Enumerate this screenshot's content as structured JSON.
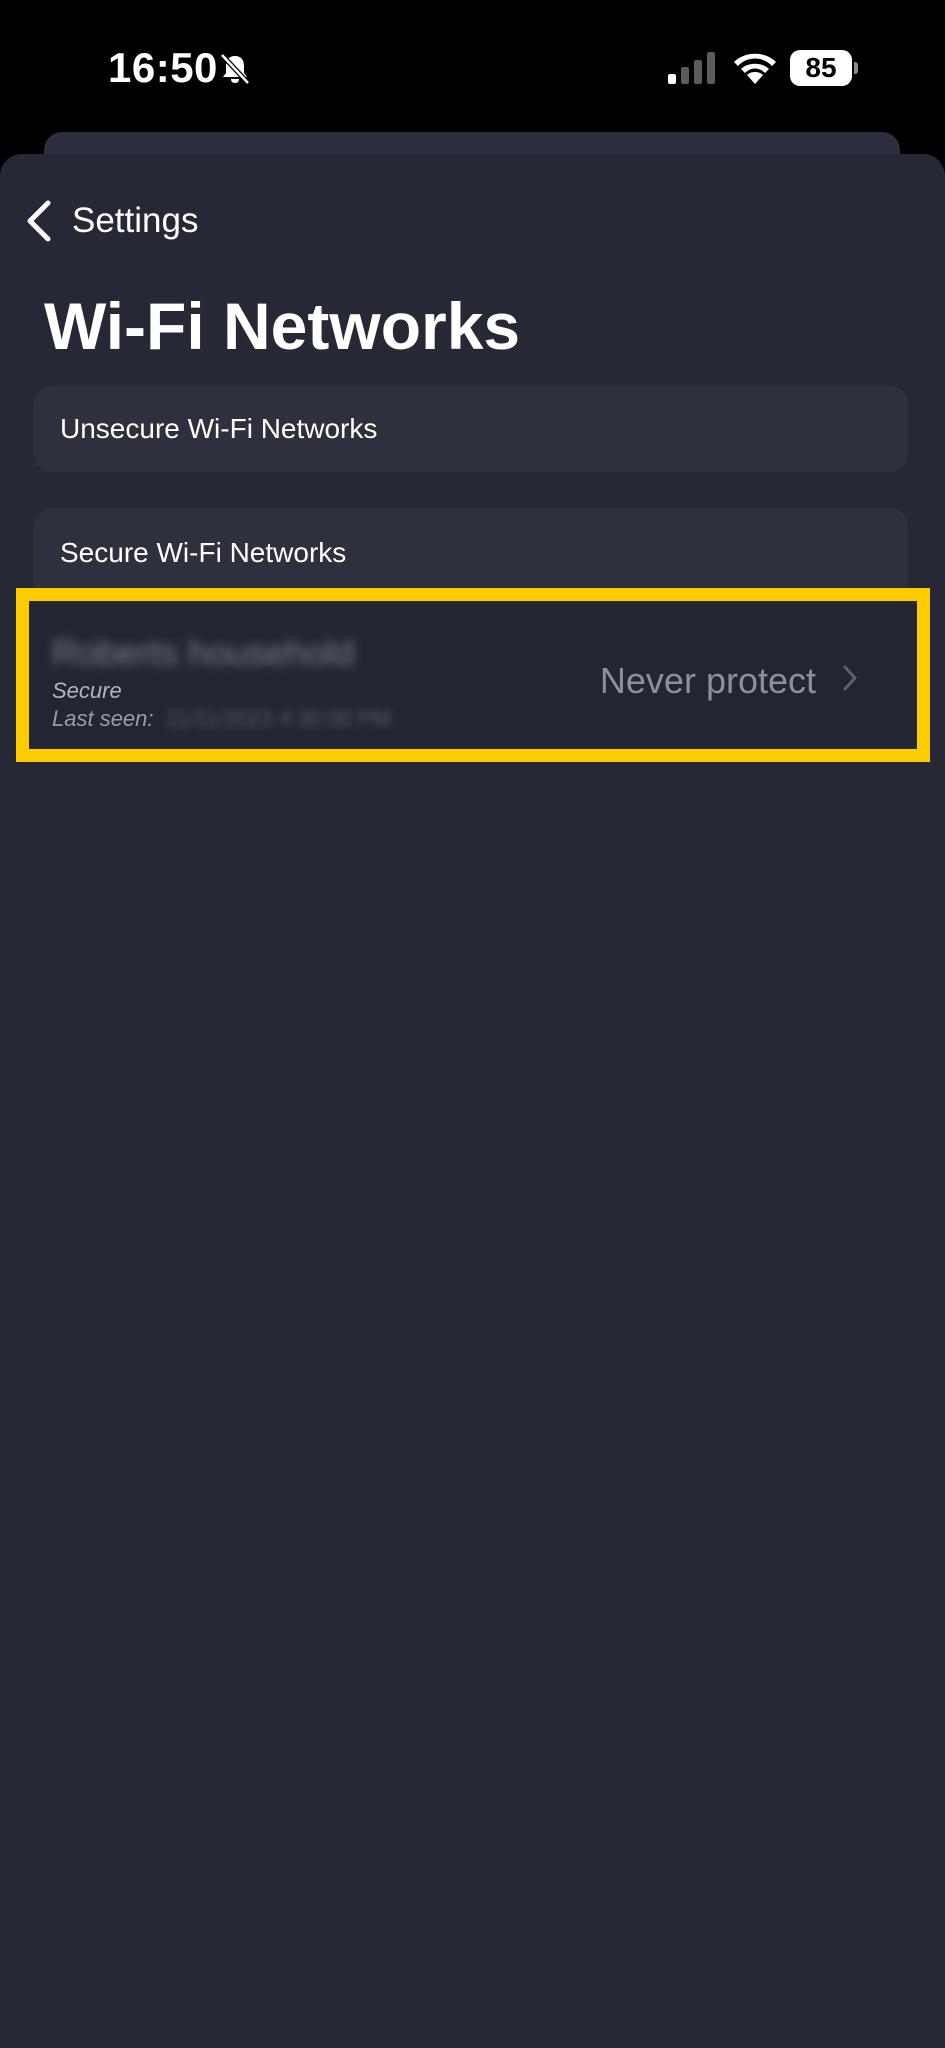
{
  "status_bar": {
    "time": "16:50",
    "battery": "85"
  },
  "nav": {
    "back_label": "Settings"
  },
  "page": {
    "title": "Wi-Fi Networks"
  },
  "sections": {
    "unsecure_label": "Unsecure Wi-Fi Networks",
    "secure_label": "Secure Wi-Fi Networks"
  },
  "network_item": {
    "name": "Roberts household",
    "status": "Secure",
    "last_seen_label": "Last seen:",
    "last_seen_value": "11/11/2023 4:30:00 PM",
    "action": "Never protect"
  },
  "colors": {
    "sheet_background": "#272836",
    "highlight": "#ffcc00"
  },
  "icons": {
    "back": "chevron-left-icon",
    "row_disclosure": "chevron-right-icon",
    "mute": "bell-slash-icon",
    "signal": "cellular-signal-icon",
    "wifi": "wifi-icon"
  }
}
